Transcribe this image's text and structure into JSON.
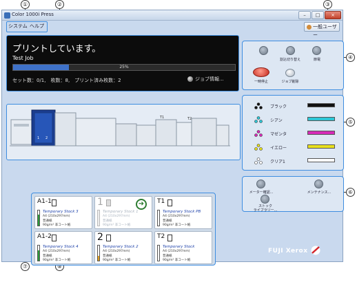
{
  "window": {
    "title": "Color 1000i Press"
  },
  "menu": {
    "system": "システム",
    "help": "ヘルプ"
  },
  "user_button": {
    "label": "一般ユーザー"
  },
  "status": {
    "headline": "プリントしています。",
    "job_name": "Test Job",
    "progress_pct": 25,
    "progress_label": "25%",
    "counts": "セット数：0/1,　枚数：8,　プリント済み枚数：2",
    "job_info_label": "ジョブ情報..."
  },
  "control_panel": {
    "interrupt_label": "割込切り替え",
    "power_save_label": "節電",
    "pause_label": "一時停止",
    "delete_job_label": "ジョブ削除"
  },
  "toner": [
    {
      "name": "ブラック",
      "color": "#111111"
    },
    {
      "name": "シアン",
      "color": "#2cc7d6"
    },
    {
      "name": "マゼンタ",
      "color": "#d62bb8"
    },
    {
      "name": "イエロー",
      "color": "#e8e01c"
    },
    {
      "name": "クリア1",
      "color": "#ffffff"
    }
  ],
  "tools": {
    "meter_label": "メーター確認...",
    "maintenance_label": "メンテナンス...",
    "stock_library_label": "ストック\nライブラリー..."
  },
  "machine_labels": {
    "t1": "T1",
    "t2": "T2"
  },
  "trays": [
    {
      "id": "A1-1",
      "stock": "Temporary Stock 3",
      "size": "A4 (210x297mm)",
      "type": "普通紙",
      "weight": "90g/m²  非コート紙",
      "level": 0.75,
      "level_color": "#2e9c3a",
      "enabled": true
    },
    {
      "id": "1",
      "stock": "Temporary Stock 1",
      "size": "A4 (210x297mm)",
      "type": "普通紙",
      "weight": "90g/m²  非コート紙",
      "level": 0.0,
      "level_color": "#aaaaaa",
      "enabled": false
    },
    {
      "id": "T1",
      "stock": "Temporary Stock PB",
      "size": "A4 (210x297mm)",
      "type": "普通紙",
      "weight": "90g/m²  非コート紙",
      "level": 0.0,
      "level_color": "#d23030",
      "enabled": true
    },
    {
      "id": "A1-2",
      "stock": "Temporary Stock 4",
      "size": "A4 (210x297mm)",
      "type": "普通紙",
      "weight": "90g/m²  非コート紙",
      "level": 0.7,
      "level_color": "#2e9c3a",
      "enabled": true
    },
    {
      "id": "2",
      "stock": "Temporary Stock 2",
      "size": "A4 (210x297mm)",
      "type": "普通紙",
      "weight": "90g/m²  非コート紙",
      "level": 0.3,
      "level_color": "#e0a020",
      "enabled": true
    },
    {
      "id": "T2",
      "stock": "Temporary Stock",
      "size": "A4 (210x297mm)",
      "type": "普通紙",
      "weight": "90g/m²  非コート紙",
      "level": 0.0,
      "level_color": "#d23030",
      "enabled": true
    }
  ],
  "brand": {
    "logo_text": "FUJI Xerox"
  },
  "callouts": [
    "①",
    "②",
    "③",
    "④",
    "⑤",
    "⑥",
    "⑦",
    "⑧"
  ]
}
